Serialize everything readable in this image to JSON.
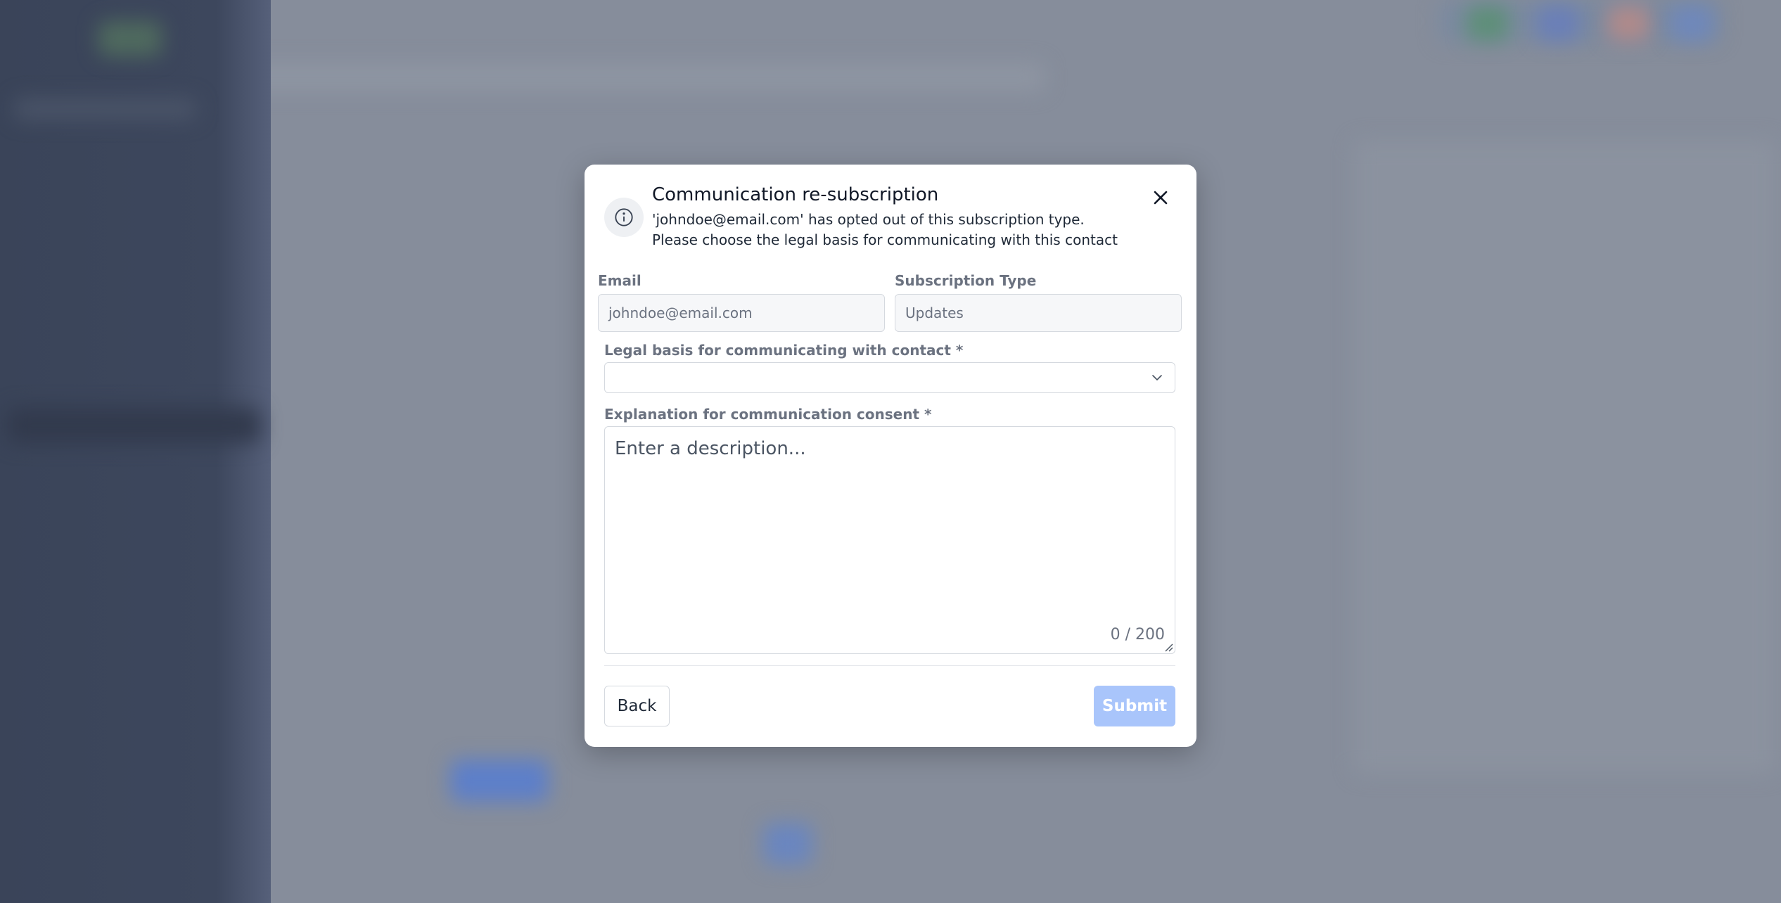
{
  "modal": {
    "title": "Communication re-subscription",
    "description": "'johndoe@email.com' has opted out of this subscription type. Please choose the legal basis for communicating with this contact",
    "email": {
      "label": "Email",
      "value": "johndoe@email.com"
    },
    "subscription_type": {
      "label": "Subscription Type",
      "value": "Updates"
    },
    "legal_basis": {
      "label": "Legal basis for communicating with contact *",
      "value": ""
    },
    "explanation": {
      "label": "Explanation for communication consent *",
      "placeholder": "Enter a description...",
      "counter": "0 / 200"
    },
    "buttons": {
      "back": "Back",
      "submit": "Submit"
    },
    "icons": {
      "info": "info-circle-icon",
      "close": "close-icon",
      "chevron": "chevron-down-icon",
      "resize": "resize-handle-icon"
    },
    "colors": {
      "submit_disabled": "#a9c5fb",
      "overlay": "#8a919f"
    }
  }
}
